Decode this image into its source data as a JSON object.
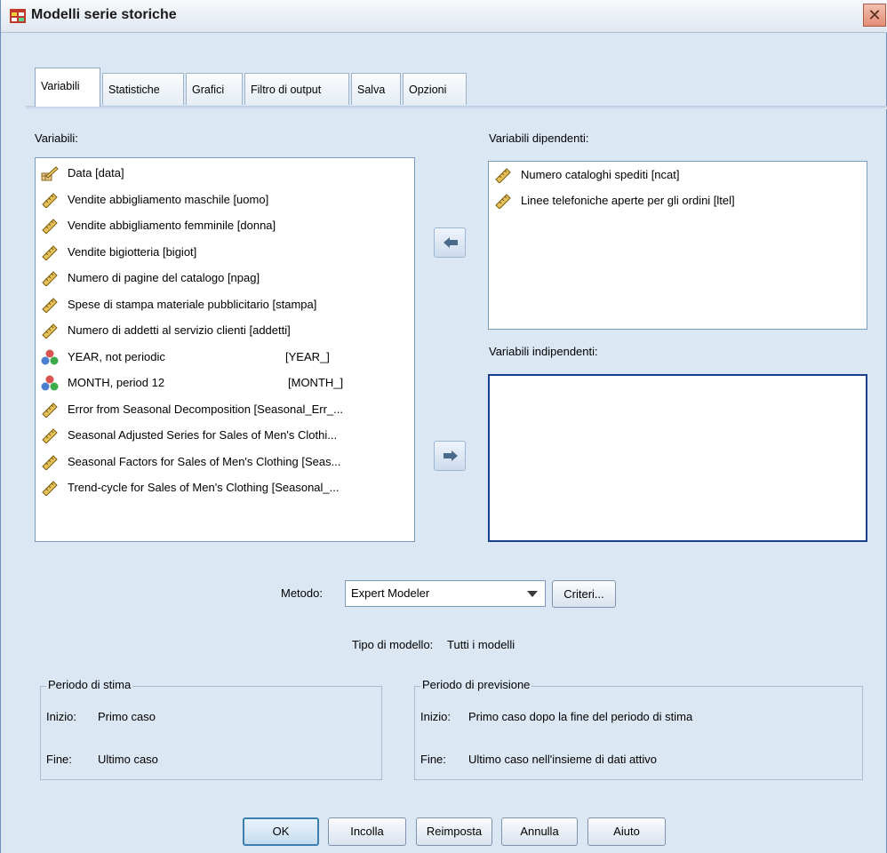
{
  "window": {
    "title": "Modelli serie storiche"
  },
  "tabs": [
    {
      "label": "Variabili"
    },
    {
      "label": "Statistiche"
    },
    {
      "label": "Grafici"
    },
    {
      "label": "Filtro di output"
    },
    {
      "label": "Salva"
    },
    {
      "label": "Opzioni"
    }
  ],
  "left_panel": {
    "label": "Variabili:",
    "items": [
      {
        "name": "Data [data]",
        "icon": "date-icon"
      },
      {
        "name": "Vendite abbigliamento maschile [uomo]",
        "icon": "ruler-icon"
      },
      {
        "name": "Vendite abbigliamento femminile [donna]",
        "icon": "ruler-icon"
      },
      {
        "name": "Vendite bigiotteria [bigiot]",
        "icon": "ruler-icon"
      },
      {
        "name": "Numero di pagine del catalogo [npag]",
        "icon": "ruler-icon"
      },
      {
        "name": "Spese di stampa materiale pubblicitario [stampa]",
        "icon": "ruler-icon"
      },
      {
        "name": "Numero di addetti al servizio clienti [addetti]",
        "icon": "ruler-icon"
      },
      {
        "name": "YEAR, not periodic",
        "tag": "[YEAR_]",
        "icon": "nominal-icon"
      },
      {
        "name": "MONTH, period 12",
        "tag": "[MONTH_]",
        "icon": "nominal-icon"
      },
      {
        "name": "Error from Seasonal Decomposition [Seasonal_Err_...",
        "icon": "ruler-icon"
      },
      {
        "name": "Seasonal Adjusted Series for Sales of Men's Clothi...",
        "icon": "ruler-icon"
      },
      {
        "name": "Seasonal Factors for Sales of Men's Clothing [Seas...",
        "icon": "ruler-icon"
      },
      {
        "name": "Trend-cycle for Sales of Men's Clothing [Seasonal_...",
        "icon": "ruler-icon"
      }
    ]
  },
  "dependent": {
    "label": "Variabili dipendenti:",
    "items": [
      {
        "name": "Numero cataloghi spediti [ncat]",
        "icon": "ruler-icon"
      },
      {
        "name": "Linee telefoniche aperte per gli ordini [ltel]",
        "icon": "ruler-icon"
      }
    ]
  },
  "independent": {
    "label": "Variabili indipendenti:",
    "items": []
  },
  "method": {
    "label": "Metodo:",
    "value": "Expert Modeler",
    "criteria_button": "Criteri...",
    "model_type_label": "Tipo di modello:",
    "model_type_value": "Tutti i modelli"
  },
  "estimation": {
    "title": "Periodo di stima",
    "start_label": "Inizio:",
    "start_value": "Primo caso",
    "end_label": "Fine:",
    "end_value": "Ultimo caso"
  },
  "forecast": {
    "title": "Periodo di previsione",
    "start_label": "Inizio:",
    "start_value": "Primo caso dopo la fine del periodo di stima",
    "end_label": "Fine:",
    "end_value": "Ultimo caso nell'insieme di dati attivo"
  },
  "buttons": {
    "ok": "OK",
    "paste": "Incolla",
    "reset": "Reimposta",
    "cancel": "Annulla",
    "help": "Aiuto"
  }
}
